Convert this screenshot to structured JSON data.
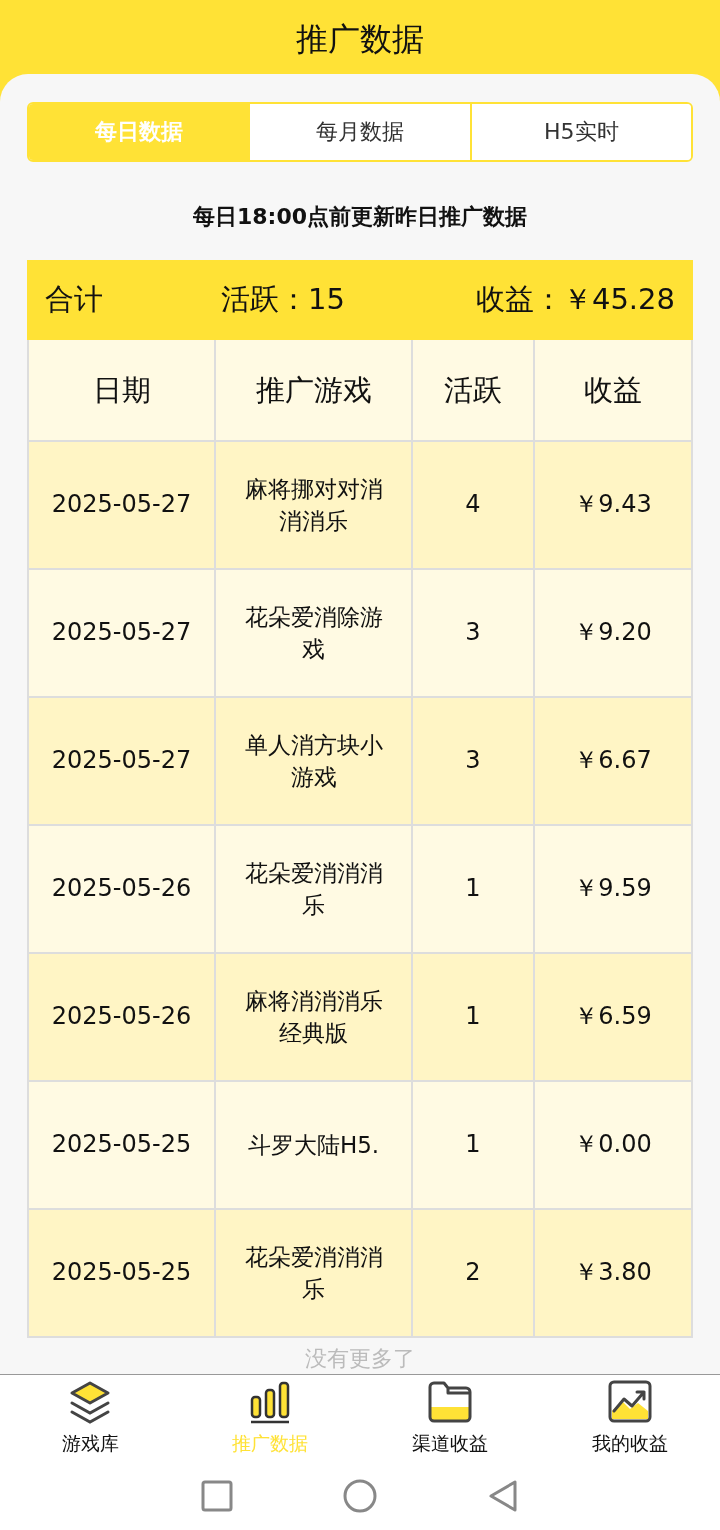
{
  "header": {
    "title": "推广数据"
  },
  "tabs": [
    {
      "label": "每日数据",
      "selected": true
    },
    {
      "label": "每月数据",
      "selected": false
    },
    {
      "label": "H5实时",
      "selected": false
    }
  ],
  "notice": "每日18:00点前更新昨日推广数据",
  "summary": {
    "label": "合计",
    "active": "活跃：15",
    "income": "收益：￥45.28"
  },
  "table": {
    "columns": [
      "日期",
      "推广游戏",
      "活跃",
      "收益"
    ],
    "rows": [
      {
        "cells": [
          "2025-05-27",
          "麻将挪对对消消消乐",
          "4",
          "￥9.43"
        ]
      },
      {
        "cells": [
          "2025-05-27",
          "花朵爱消除游戏",
          "3",
          "￥9.20"
        ]
      },
      {
        "cells": [
          "2025-05-27",
          "单人消方块小游戏",
          "3",
          "￥6.67"
        ]
      },
      {
        "cells": [
          "2025-05-26",
          "花朵爱消消消乐",
          "1",
          "￥9.59"
        ]
      },
      {
        "cells": [
          "2025-05-26",
          "麻将消消消乐经典版",
          "1",
          "￥6.59"
        ]
      },
      {
        "cells": [
          "2025-05-25",
          "斗罗大陆H5.",
          "1",
          "￥0.00"
        ]
      },
      {
        "cells": [
          "2025-05-25",
          "花朵爱消消消乐",
          "2",
          "￥3.80"
        ]
      }
    ]
  },
  "footer_note": "没有更多了",
  "nav": [
    {
      "label": "游戏库",
      "kind": "layers",
      "selected": false
    },
    {
      "label": "推广数据",
      "kind": "bars",
      "selected": true
    },
    {
      "label": "渠道收益",
      "kind": "folder",
      "selected": false
    },
    {
      "label": "我的收益",
      "kind": "chart",
      "selected": false
    }
  ]
}
